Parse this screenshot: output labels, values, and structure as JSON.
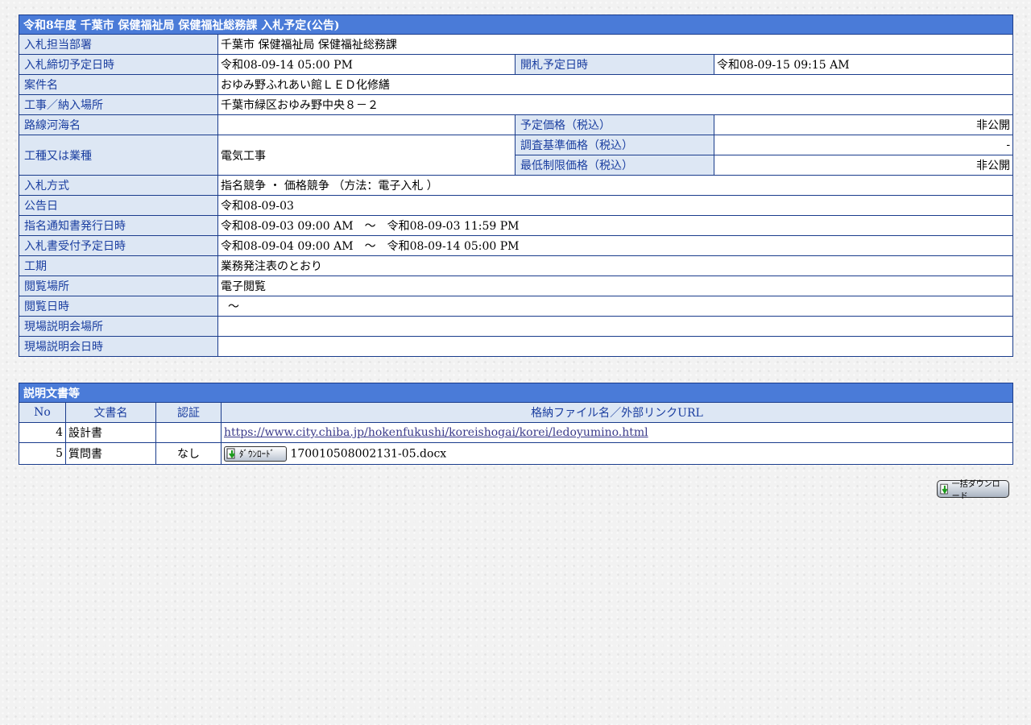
{
  "info": {
    "title": "令和8年度 千葉市 保健福祉局 保健福祉総務課 入札予定(公告)",
    "rows": {
      "dept": {
        "label": "入札担当部署",
        "value": "千葉市 保健福祉局 保健福祉総務課"
      },
      "deadline": {
        "label": "入札締切予定日時",
        "value": "令和08-09-14 05:00 PM"
      },
      "opening": {
        "label": "開札予定日時",
        "value": "令和08-09-15 09:15 AM"
      },
      "case_name": {
        "label": "案件名",
        "value": "おゆみ野ふれあい館ＬＥＤ化修繕"
      },
      "location": {
        "label": "工事／納入場所",
        "value": "千葉市緑区おゆみ野中央８－２"
      },
      "route": {
        "label": "路線河海名",
        "value": ""
      },
      "planned_price": {
        "label": "予定価格（税込）",
        "value": "非公開"
      },
      "work_type": {
        "label": "工種又は業種",
        "value": "電気工事"
      },
      "survey_price": {
        "label": "調査基準価格（税込）",
        "value": "-"
      },
      "min_price": {
        "label": "最低制限価格（税込）",
        "value": "非公開"
      },
      "method": {
        "label": "入札方式",
        "value": "指名競争 ・ 価格競争 （方法：電子入札 ）"
      },
      "notice_date": {
        "label": "公告日",
        "value": "令和08-09-03"
      },
      "nomination": {
        "label": "指名通知書発行日時",
        "value": "令和08-09-03 09:00 AM　～　令和08-09-03 11:59 PM"
      },
      "reception": {
        "label": "入札書受付予定日時",
        "value": "令和08-09-04 09:00 AM　～　令和08-09-14 05:00 PM"
      },
      "period": {
        "label": "工期",
        "value": "業務発注表のとおり"
      },
      "viewing_place": {
        "label": "閲覧場所",
        "value": "電子閲覧"
      },
      "viewing_date": {
        "label": "閲覧日時",
        "value": "～"
      },
      "site_place": {
        "label": "現場説明会場所",
        "value": ""
      },
      "site_date": {
        "label": "現場説明会日時",
        "value": ""
      }
    }
  },
  "docs": {
    "title": "説明文書等",
    "headers": {
      "no": "No",
      "name": "文書名",
      "cert": "認証",
      "file": "格納ファイル名／外部リンクURL"
    },
    "rows": [
      {
        "no": "4",
        "name": "設計書",
        "cert": "",
        "file": "https://www.city.chiba.jp/hokenfukushi/koreishogai/korei/ledoyumino.html"
      },
      {
        "no": "5",
        "name": "質問書",
        "cert": "なし",
        "file": "170010508002131-05.docx"
      }
    ],
    "download_label": "ﾀﾞｳﾝﾛｰﾄﾞ"
  },
  "bulk_download_label": "一括ダウンロード",
  "colors": {
    "header_bg": "#4a7bd8",
    "label_bg": "#dde7f4",
    "label_text": "#1a3ea0",
    "border": "#1a3c8c"
  },
  "icons": {
    "download": "download-arrow-icon",
    "bulk_download": "bulk-download-arrow-icon"
  }
}
